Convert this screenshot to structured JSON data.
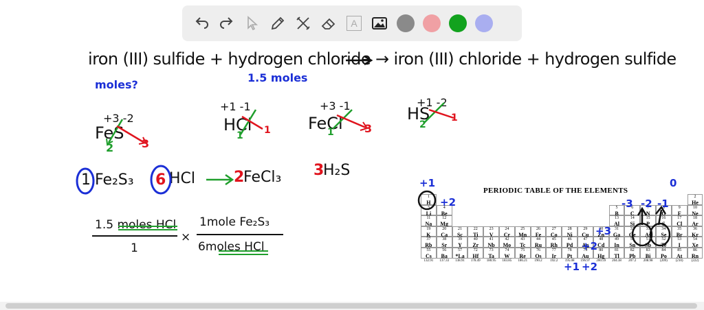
{
  "toolbar": {
    "tools": [
      "undo-icon",
      "redo-icon",
      "select-icon",
      "pen-icon",
      "tools-icon",
      "eraser-icon",
      "text-icon",
      "image-icon"
    ],
    "text_tool_label": "A",
    "colors": [
      "#8a8a8a",
      "#f0a0a4",
      "#12a21e",
      "#a9aef0"
    ],
    "selected_color": "#12a21e"
  },
  "notes": {
    "equation_words": "iron (III) sulfide + hydrogen chloride → iron (III) chloride + hydrogen sulfide",
    "moles_q": "moles?",
    "given": "1.5 moles",
    "fe_ox": "+3  -2",
    "fe_formula": "FeS",
    "fe_cross_2": "2",
    "fe_cross_3": "3",
    "h_ox": "+1  -1",
    "h_formula": "HCl",
    "h_cross_1a": "1",
    "h_cross_1b": "1",
    "fecl_ox": "+3  -1",
    "fecl_formula": "FeCl",
    "fecl_cross_1": "1",
    "fecl_cross_3": "3",
    "hs_ox": "+1  -2",
    "hs_formula": "HS",
    "hs_cross_2": "2",
    "hs_cross_1": "1",
    "balanced": {
      "c1": "1",
      "f1": "Fe₂S₃",
      "c2": "6",
      "f2": "HCl",
      "c3": "2",
      "f3": "FeCl₃",
      "c4": "3",
      "f4": "H₂S"
    },
    "calc": {
      "num1": "1.5 moles HCl",
      "den1": "1",
      "times": "×",
      "num2": "1mole Fe₂S₃",
      "den2": "6moles HCl"
    },
    "pt_annotations": [
      "+1",
      "+2",
      "+3",
      "+2",
      "+1",
      "+2",
      "0",
      "-3",
      "-2",
      "-1"
    ]
  },
  "periodic_table": {
    "title": "PERIODIC TABLE OF THE ELEMENTS",
    "elements": [
      {
        "n": "1",
        "s": "H",
        "m": "1.008"
      },
      {
        "n": "2",
        "s": "He",
        "m": "4.00"
      },
      {
        "n": "3",
        "s": "Li",
        "m": "6.94"
      },
      {
        "n": "4",
        "s": "Be",
        "m": "9.01"
      },
      {
        "n": "5",
        "s": "B",
        "m": "10.81"
      },
      {
        "n": "6",
        "s": "C",
        "m": "12.01"
      },
      {
        "n": "7",
        "s": "N",
        "m": "14.01"
      },
      {
        "n": "8",
        "s": "O",
        "m": "16.00"
      },
      {
        "n": "9",
        "s": "F",
        "m": "19.00"
      },
      {
        "n": "10",
        "s": "Ne",
        "m": "20.18"
      },
      {
        "n": "11",
        "s": "Na",
        "m": "22.99"
      },
      {
        "n": "12",
        "s": "Mg",
        "m": "24.30"
      },
      {
        "n": "13",
        "s": "Al",
        "m": "26.98"
      },
      {
        "n": "14",
        "s": "Si",
        "m": "28.09"
      },
      {
        "n": "15",
        "s": "P",
        "m": "30.97"
      },
      {
        "n": "16",
        "s": "S",
        "m": "32.06"
      },
      {
        "n": "17",
        "s": "Cl",
        "m": "35.45"
      },
      {
        "n": "18",
        "s": "Ar",
        "m": "39.95"
      },
      {
        "n": "19",
        "s": "K",
        "m": "39.10"
      },
      {
        "n": "20",
        "s": "Ca",
        "m": "40.08"
      },
      {
        "n": "21",
        "s": "Sc",
        "m": "44.96"
      },
      {
        "n": "22",
        "s": "Ti",
        "m": "47.90"
      },
      {
        "n": "23",
        "s": "V",
        "m": "50.94"
      },
      {
        "n": "24",
        "s": "Cr",
        "m": "52.00"
      },
      {
        "n": "25",
        "s": "Mn",
        "m": "54.94"
      },
      {
        "n": "26",
        "s": "Fe",
        "m": "55.85"
      },
      {
        "n": "27",
        "s": "Co",
        "m": "58.93"
      },
      {
        "n": "28",
        "s": "Ni",
        "m": "58.69"
      },
      {
        "n": "29",
        "s": "Cu",
        "m": "63.55"
      },
      {
        "n": "30",
        "s": "Zn",
        "m": "65.39"
      },
      {
        "n": "31",
        "s": "Ga",
        "m": "69.72"
      },
      {
        "n": "32",
        "s": "Ge",
        "m": "72.59"
      },
      {
        "n": "33",
        "s": "As",
        "m": "74.92"
      },
      {
        "n": "34",
        "s": "Se",
        "m": "78.96"
      },
      {
        "n": "35",
        "s": "Br",
        "m": "79.90"
      },
      {
        "n": "36",
        "s": "Kr",
        "m": "83.80"
      },
      {
        "n": "37",
        "s": "Rb",
        "m": "85.47"
      },
      {
        "n": "38",
        "s": "Sr",
        "m": "87.62"
      },
      {
        "n": "39",
        "s": "Y",
        "m": "88.91"
      },
      {
        "n": "40",
        "s": "Zr",
        "m": "91.22"
      },
      {
        "n": "41",
        "s": "Nb",
        "m": "92.91"
      },
      {
        "n": "42",
        "s": "Mo",
        "m": "95.94"
      },
      {
        "n": "43",
        "s": "Tc",
        "m": "(98)"
      },
      {
        "n": "44",
        "s": "Ru",
        "m": "101.1"
      },
      {
        "n": "45",
        "s": "Rh",
        "m": "102.91"
      },
      {
        "n": "46",
        "s": "Pd",
        "m": "106.42"
      },
      {
        "n": "47",
        "s": "Ag",
        "m": "107.87"
      },
      {
        "n": "48",
        "s": "Cd",
        "m": "112.41"
      },
      {
        "n": "49",
        "s": "In",
        "m": "114.82"
      },
      {
        "n": "50",
        "s": "Sn",
        "m": "118.71"
      },
      {
        "n": "51",
        "s": "Sb",
        "m": "121.75"
      },
      {
        "n": "52",
        "s": "Te",
        "m": "127.60"
      },
      {
        "n": "53",
        "s": "I",
        "m": "126.91"
      },
      {
        "n": "54",
        "s": "Xe",
        "m": "131.29"
      },
      {
        "n": "55",
        "s": "Cs",
        "m": "132.91"
      },
      {
        "n": "56",
        "s": "Ba",
        "m": "137.33"
      },
      {
        "n": "57",
        "s": "*La",
        "m": "138.91"
      },
      {
        "n": "72",
        "s": "Hf",
        "m": "178.49"
      },
      {
        "n": "73",
        "s": "Ta",
        "m": "180.95"
      },
      {
        "n": "74",
        "s": "W",
        "m": "183.85"
      },
      {
        "n": "75",
        "s": "Re",
        "m": "186.21"
      },
      {
        "n": "76",
        "s": "Os",
        "m": "190.2"
      },
      {
        "n": "77",
        "s": "Ir",
        "m": "192.2"
      },
      {
        "n": "78",
        "s": "Pt",
        "m": "195.08"
      },
      {
        "n": "79",
        "s": "Au",
        "m": "196.97"
      },
      {
        "n": "80",
        "s": "Hg",
        "m": "200.59"
      },
      {
        "n": "81",
        "s": "Tl",
        "m": "204.38"
      },
      {
        "n": "82",
        "s": "Pb",
        "m": "207.2"
      },
      {
        "n": "83",
        "s": "Bi",
        "m": "208.98"
      },
      {
        "n": "84",
        "s": "Po",
        "m": "(209)"
      },
      {
        "n": "85",
        "s": "At",
        "m": "(210)"
      },
      {
        "n": "86",
        "s": "Rn",
        "m": "(222)"
      }
    ]
  }
}
